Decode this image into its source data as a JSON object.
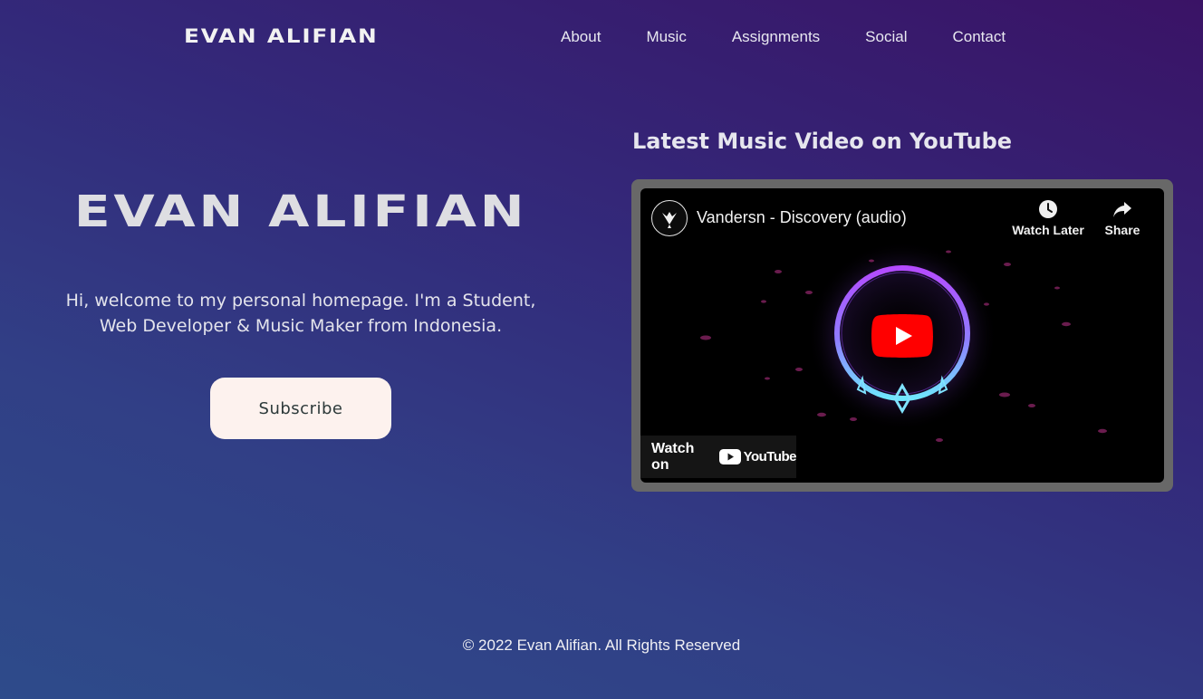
{
  "header": {
    "logo": "EVAN ALIFIAN",
    "nav": [
      "About",
      "Music",
      "Assignments",
      "Social",
      "Contact"
    ]
  },
  "hero": {
    "title": "EVAN ALIFIAN",
    "intro_line1": "Hi, welcome to my personal homepage. I'm a Student,",
    "intro_line2": "Web Developer & Music Maker from Indonesia.",
    "subscribe_label": "Subscribe"
  },
  "video": {
    "heading": "Latest Music Video on YouTube",
    "title": "Vandersn - Discovery (audio)",
    "watch_later_label": "Watch Later",
    "share_label": "Share",
    "watch_on_label": "Watch on",
    "youtube_wordmark": "YouTube",
    "icons": [
      "channel-avatar-icon",
      "clock-icon",
      "share-arrow-icon",
      "play-button-icon",
      "youtube-logo-icon"
    ]
  },
  "footer": {
    "copyright": "© 2022 Evan Alifian. All Rights Reserved"
  },
  "colors": {
    "accent_button_bg": "#fdf2ee",
    "youtube_red": "#ff0000",
    "frame_gray": "#686868"
  }
}
